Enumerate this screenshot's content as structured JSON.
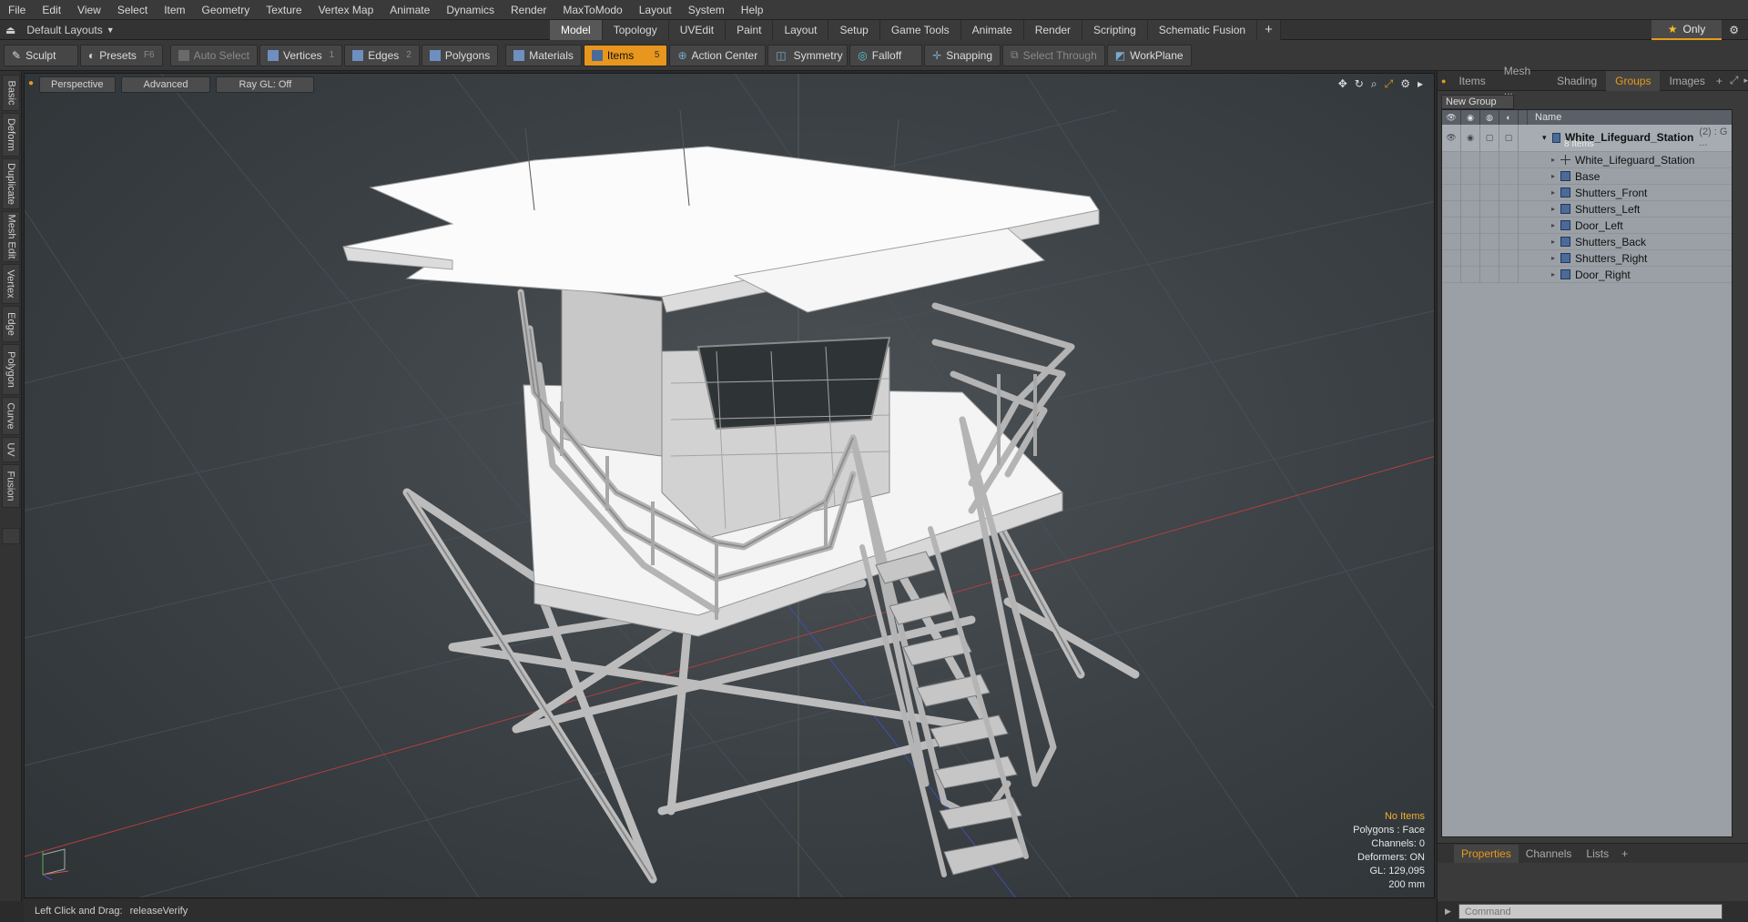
{
  "menu": [
    "File",
    "Edit",
    "View",
    "Select",
    "Item",
    "Geometry",
    "Texture",
    "Vertex Map",
    "Animate",
    "Dynamics",
    "Render",
    "MaxToModo",
    "Layout",
    "System",
    "Help"
  ],
  "layout": {
    "selector": "Default Layouts",
    "tabs": [
      "Model",
      "Topology",
      "UVEdit",
      "Paint",
      "Layout",
      "Setup",
      "Game Tools",
      "Animate",
      "Render",
      "Scripting",
      "Schematic Fusion"
    ],
    "active_tab": "Model",
    "only_label": "Only"
  },
  "toolbar": {
    "sculpt": "Sculpt",
    "presets": "Presets",
    "presets_key": "F6",
    "auto_select": "Auto Select",
    "vertices": "Vertices",
    "vertices_key": "1",
    "edges": "Edges",
    "edges_key": "2",
    "polygons": "Polygons",
    "materials": "Materials",
    "items": "Items",
    "items_key": "5",
    "action_center": "Action Center",
    "symmetry": "Symmetry",
    "falloff": "Falloff",
    "snapping": "Snapping",
    "select_through": "Select Through",
    "workplane": "WorkPlane"
  },
  "left_tabs": [
    "Basic",
    "Deform",
    "Duplicate",
    "Mesh Edit",
    "Vertex",
    "Edge",
    "Polygon",
    "Curve",
    "UV",
    "Fusion"
  ],
  "viewport": {
    "view": "Perspective",
    "shading": "Advanced",
    "raygl": "Ray GL: Off",
    "info": {
      "no_items": "No Items",
      "polygons": "Polygons : Face",
      "channels": "Channels: 0",
      "deformers": "Deformers: ON",
      "gl": "GL: 129,095",
      "scale": "200 mm"
    }
  },
  "status": {
    "hint_label": "Left Click and Drag:",
    "hint_value": "releaseVerify"
  },
  "right_panel": {
    "tabs": [
      "Items",
      "Mesh ...",
      "Shading",
      "Groups",
      "Images"
    ],
    "active_tab": "Groups",
    "new_group": "New Group",
    "name_header": "Name",
    "root": {
      "name": "White_Lifeguard_Station",
      "extra": "(2) : G ...",
      "count": "8 Items"
    },
    "items": [
      {
        "name": "White_Lifeguard_Station",
        "icon": "locator-icon"
      },
      {
        "name": "Base",
        "icon": "mesh-icon"
      },
      {
        "name": "Shutters_Front",
        "icon": "mesh-icon"
      },
      {
        "name": "Shutters_Left",
        "icon": "mesh-icon"
      },
      {
        "name": "Door_Left",
        "icon": "mesh-icon"
      },
      {
        "name": "Shutters_Back",
        "icon": "mesh-icon"
      },
      {
        "name": "Shutters_Right",
        "icon": "mesh-icon"
      },
      {
        "name": "Door_Right",
        "icon": "mesh-icon"
      }
    ],
    "props_tabs": [
      "Properties",
      "Channels",
      "Lists"
    ],
    "props_active": "Properties",
    "command_placeholder": "Command"
  }
}
